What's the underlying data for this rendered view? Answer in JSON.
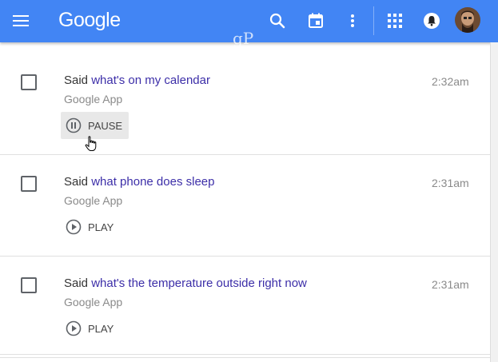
{
  "header": {
    "logo": "Google",
    "watermark": "gP",
    "icons": [
      "menu-icon",
      "search-icon",
      "calendar-icon",
      "more-vert-icon",
      "apps-grid-icon",
      "notifications-icon",
      "avatar"
    ]
  },
  "items": [
    {
      "said_prefix": "Said",
      "query": "what's on my calendar",
      "source": "Google App",
      "time": "2:32am",
      "action": "PAUSE"
    },
    {
      "said_prefix": "Said",
      "query": "what phone does sleep",
      "source": "Google App",
      "time": "2:31am",
      "action": "PLAY"
    },
    {
      "said_prefix": "Said",
      "query": "what's the temperature outside right now",
      "source": "Google App",
      "time": "2:31am",
      "action": "PLAY"
    }
  ],
  "colors": {
    "topbar": "#4285f4",
    "query_text": "#3c2ea8"
  }
}
